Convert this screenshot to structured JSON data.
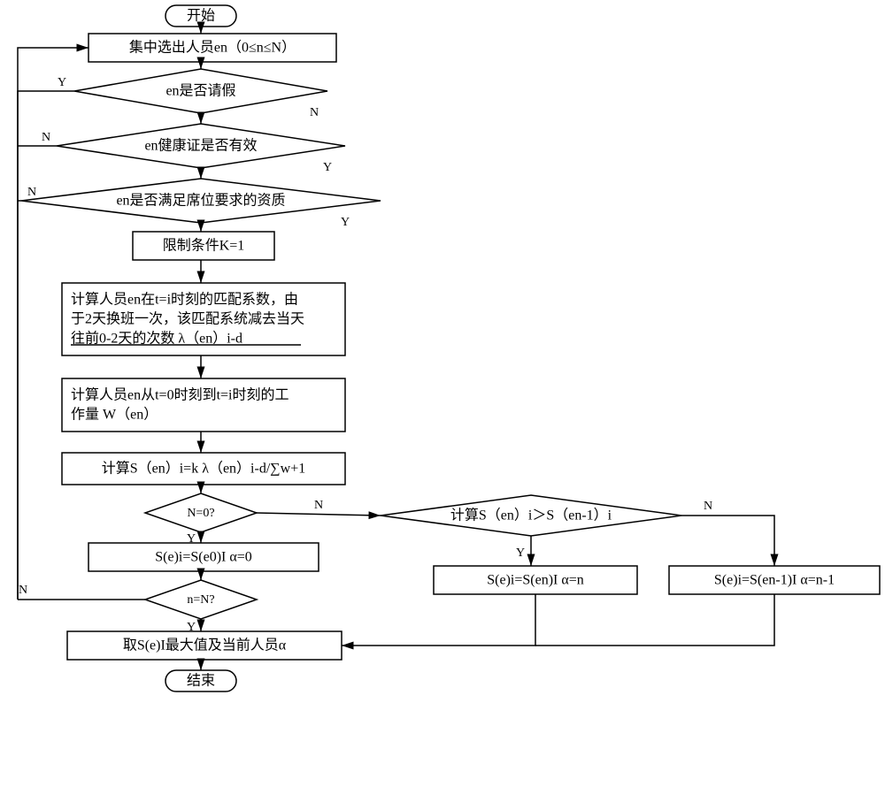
{
  "chart_data": {
    "type": "flowchart",
    "start": "开始",
    "end": "结束",
    "nodes": [
      {
        "id": "select",
        "type": "process",
        "text": "集中选出人员en（0≤n≤N）"
      },
      {
        "id": "leave",
        "type": "decision",
        "text": "en是否请假",
        "yes": "loop_back",
        "no": "health"
      },
      {
        "id": "health",
        "type": "decision",
        "text": "en健康证是否有效",
        "yes": "qual",
        "no": "loop_back"
      },
      {
        "id": "qual",
        "type": "decision",
        "text": "en是否满足席位要求的资质",
        "yes": "k1",
        "no": "loop_back"
      },
      {
        "id": "k1",
        "type": "process",
        "text": "限制条件K=1"
      },
      {
        "id": "match",
        "type": "process",
        "text": "计算人员en在t=i时刻的匹配系数，由于2天换班一次，该匹配系统减去当天往前0-2天的次数  λ（en）i-d"
      },
      {
        "id": "work",
        "type": "process",
        "text": "计算人员en从t=0时刻到t=i时刻的工作量  W（en）"
      },
      {
        "id": "calcS",
        "type": "process",
        "text": "计算S（en）i=k λ（en）i-d/∑w+1"
      },
      {
        "id": "n0",
        "type": "decision",
        "text": "N=0?",
        "yes": "alpha0",
        "no": "cmp"
      },
      {
        "id": "alpha0",
        "type": "process",
        "text": "S(e)i=S(e0)I  α=0"
      },
      {
        "id": "cmp",
        "type": "decision",
        "text": "计算S（en）i＞S（en-1）i",
        "yes": "alphan",
        "no": "alphan1"
      },
      {
        "id": "alphan",
        "type": "process",
        "text": "S(e)i=S(en)I  α=n"
      },
      {
        "id": "alphan1",
        "type": "process",
        "text": "S(e)i=S(en-1)I  α=n-1"
      },
      {
        "id": "nN",
        "type": "decision",
        "text": "n=N?",
        "yes": "take",
        "no": "loop_back"
      },
      {
        "id": "take",
        "type": "process",
        "text": "取S(e)I最大值及当前人员α"
      }
    ],
    "labels": {
      "Y": "Y",
      "N": "N"
    }
  },
  "nodes": {
    "start": "开始",
    "select": "集中选出人员en（0≤n≤N）",
    "leave": "en是否请假",
    "health": "en健康证是否有效",
    "qual": "en是否满足席位要求的资质",
    "k1": "限制条件K=1",
    "match_l1": "计算人员en在t=i时刻的匹配系数，由",
    "match_l2": "于2天换班一次，该匹配系统减去当天",
    "match_l3": "往前0-2天的次数   λ（en）i-d",
    "work_l1": "计算人员en从t=0时刻到t=i时刻的工",
    "work_l2": "作量   W（en）",
    "calcS": "计算S（en）i=k  λ（en）i-d/∑w+1",
    "n0": "N=0?",
    "alpha0": "S(e)i=S(e0)I  α=0",
    "cmp": "计算S（en）i＞S（en-1）i",
    "alphan": "S(e)i=S(en)I  α=n",
    "alphan1": "S(e)i=S(en-1)I  α=n-1",
    "nN": "n=N?",
    "take": "取S(e)I最大值及当前人员α",
    "end": "结束"
  },
  "labels": {
    "Y": "Y",
    "N": "N"
  }
}
